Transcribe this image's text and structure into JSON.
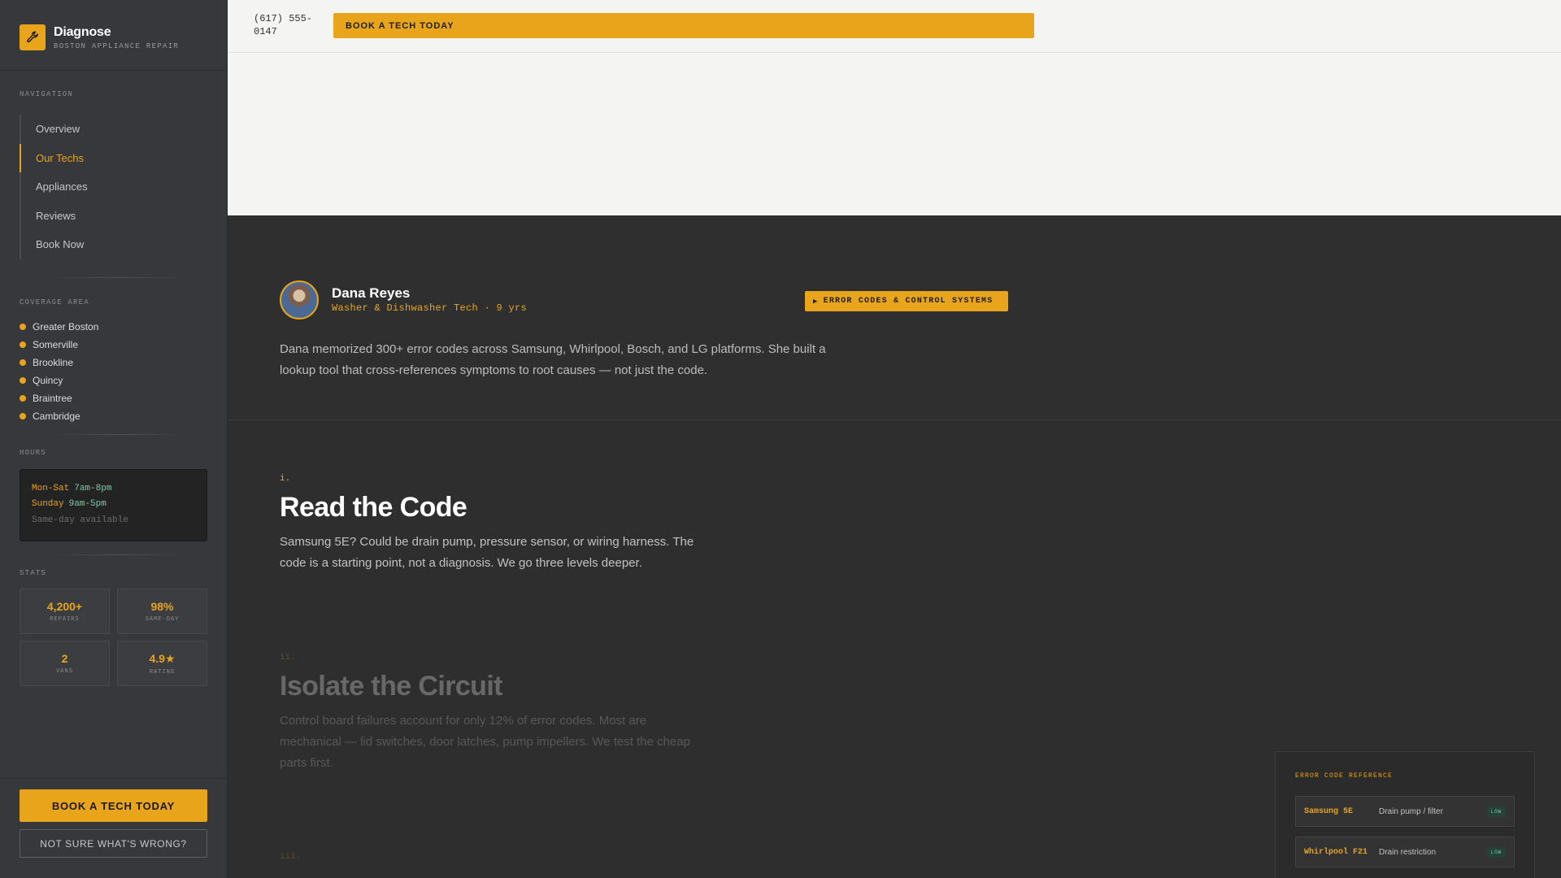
{
  "brand": {
    "name": "Diagnose",
    "subtitle": "BOSTON APPLIANCE REPAIR",
    "icon": "wrench-icon",
    "accent_color": "#e8a51c"
  },
  "sidebar": {
    "nav_label": "NAVIGATION",
    "nav_items": [
      {
        "label": "Overview",
        "active": false
      },
      {
        "label": "Our Techs",
        "active": true
      },
      {
        "label": "Appliances",
        "active": false
      },
      {
        "label": "Reviews",
        "active": false
      },
      {
        "label": "Book Now",
        "active": false
      }
    ],
    "coverage_label": "COVERAGE AREA",
    "coverage_items": [
      "Greater Boston",
      "Somerville",
      "Brookline",
      "Quincy",
      "Braintree",
      "Cambridge"
    ],
    "hours_label": "HOURS",
    "hours": {
      "rows": [
        {
          "day": "Mon-Sat",
          "time": "7am-8pm"
        },
        {
          "day": "Sunday",
          "time": "9am-5pm"
        }
      ],
      "note": "Same-day available"
    },
    "stats_label": "STATS",
    "stats": [
      {
        "value": "4,200+",
        "label": "REPAIRS"
      },
      {
        "value": "98%",
        "label": "SAME-DAY"
      },
      {
        "value": "2",
        "label": "VANS"
      },
      {
        "value": "4.9★",
        "label": "RATING"
      }
    ],
    "cta_primary": "BOOK A TECH TODAY",
    "cta_secondary": "NOT SURE WHAT'S WRONG?"
  },
  "topbar": {
    "phone": "(617) 555-0147",
    "cta": "BOOK A TECH TODAY"
  },
  "tech": {
    "name": "Dana Reyes",
    "role": "Washer & Dishwasher Tech · 9 yrs",
    "badge": "ERROR CODES & CONTROL SYSTEMS",
    "badge_icon": "play-triangle-icon",
    "description": "Dana memorized 300+ error codes across Samsung, Whirlpool, Bosch, and LG platforms. She built a lookup tool that cross-references symptoms to root causes — not just the code."
  },
  "steps": [
    {
      "num": "i.",
      "title": "Read the Code",
      "text": "Samsung 5E? Could be drain pump, pressure sensor, or wiring harness. The code is a starting point, not a diagnosis. We go three levels deeper."
    },
    {
      "num": "ii.",
      "title": "Isolate the Circuit",
      "text": "Control board failures account for only 12% of error codes. Most are mechanical — lid switches, door latches, pump impellers. We test the cheap parts first."
    },
    {
      "num": "iii.",
      "title": "",
      "text": ""
    }
  ],
  "error_reference": {
    "title": "ERROR CODE REFERENCE",
    "rows": [
      {
        "code": "Samsung 5E",
        "desc": "Drain pump / filter",
        "tag": "LOW"
      },
      {
        "code": "Whirlpool F21",
        "desc": "Drain restriction",
        "tag": "LOW"
      }
    ]
  }
}
